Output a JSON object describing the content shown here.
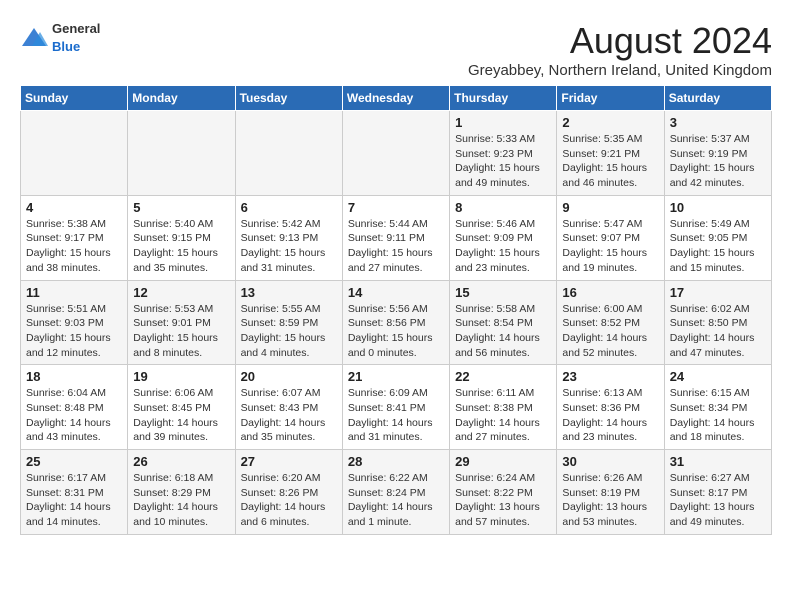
{
  "header": {
    "logo": {
      "general": "General",
      "blue": "Blue"
    },
    "title": "August 2024",
    "subtitle": "Greyabbey, Northern Ireland, United Kingdom"
  },
  "weekdays": [
    "Sunday",
    "Monday",
    "Tuesday",
    "Wednesday",
    "Thursday",
    "Friday",
    "Saturday"
  ],
  "weeks": [
    [
      {
        "day": "",
        "info": ""
      },
      {
        "day": "",
        "info": ""
      },
      {
        "day": "",
        "info": ""
      },
      {
        "day": "",
        "info": ""
      },
      {
        "day": "1",
        "info": "Sunrise: 5:33 AM\nSunset: 9:23 PM\nDaylight: 15 hours\nand 49 minutes."
      },
      {
        "day": "2",
        "info": "Sunrise: 5:35 AM\nSunset: 9:21 PM\nDaylight: 15 hours\nand 46 minutes."
      },
      {
        "day": "3",
        "info": "Sunrise: 5:37 AM\nSunset: 9:19 PM\nDaylight: 15 hours\nand 42 minutes."
      }
    ],
    [
      {
        "day": "4",
        "info": "Sunrise: 5:38 AM\nSunset: 9:17 PM\nDaylight: 15 hours\nand 38 minutes."
      },
      {
        "day": "5",
        "info": "Sunrise: 5:40 AM\nSunset: 9:15 PM\nDaylight: 15 hours\nand 35 minutes."
      },
      {
        "day": "6",
        "info": "Sunrise: 5:42 AM\nSunset: 9:13 PM\nDaylight: 15 hours\nand 31 minutes."
      },
      {
        "day": "7",
        "info": "Sunrise: 5:44 AM\nSunset: 9:11 PM\nDaylight: 15 hours\nand 27 minutes."
      },
      {
        "day": "8",
        "info": "Sunrise: 5:46 AM\nSunset: 9:09 PM\nDaylight: 15 hours\nand 23 minutes."
      },
      {
        "day": "9",
        "info": "Sunrise: 5:47 AM\nSunset: 9:07 PM\nDaylight: 15 hours\nand 19 minutes."
      },
      {
        "day": "10",
        "info": "Sunrise: 5:49 AM\nSunset: 9:05 PM\nDaylight: 15 hours\nand 15 minutes."
      }
    ],
    [
      {
        "day": "11",
        "info": "Sunrise: 5:51 AM\nSunset: 9:03 PM\nDaylight: 15 hours\nand 12 minutes."
      },
      {
        "day": "12",
        "info": "Sunrise: 5:53 AM\nSunset: 9:01 PM\nDaylight: 15 hours\nand 8 minutes."
      },
      {
        "day": "13",
        "info": "Sunrise: 5:55 AM\nSunset: 8:59 PM\nDaylight: 15 hours\nand 4 minutes."
      },
      {
        "day": "14",
        "info": "Sunrise: 5:56 AM\nSunset: 8:56 PM\nDaylight: 15 hours\nand 0 minutes."
      },
      {
        "day": "15",
        "info": "Sunrise: 5:58 AM\nSunset: 8:54 PM\nDaylight: 14 hours\nand 56 minutes."
      },
      {
        "day": "16",
        "info": "Sunrise: 6:00 AM\nSunset: 8:52 PM\nDaylight: 14 hours\nand 52 minutes."
      },
      {
        "day": "17",
        "info": "Sunrise: 6:02 AM\nSunset: 8:50 PM\nDaylight: 14 hours\nand 47 minutes."
      }
    ],
    [
      {
        "day": "18",
        "info": "Sunrise: 6:04 AM\nSunset: 8:48 PM\nDaylight: 14 hours\nand 43 minutes."
      },
      {
        "day": "19",
        "info": "Sunrise: 6:06 AM\nSunset: 8:45 PM\nDaylight: 14 hours\nand 39 minutes."
      },
      {
        "day": "20",
        "info": "Sunrise: 6:07 AM\nSunset: 8:43 PM\nDaylight: 14 hours\nand 35 minutes."
      },
      {
        "day": "21",
        "info": "Sunrise: 6:09 AM\nSunset: 8:41 PM\nDaylight: 14 hours\nand 31 minutes."
      },
      {
        "day": "22",
        "info": "Sunrise: 6:11 AM\nSunset: 8:38 PM\nDaylight: 14 hours\nand 27 minutes."
      },
      {
        "day": "23",
        "info": "Sunrise: 6:13 AM\nSunset: 8:36 PM\nDaylight: 14 hours\nand 23 minutes."
      },
      {
        "day": "24",
        "info": "Sunrise: 6:15 AM\nSunset: 8:34 PM\nDaylight: 14 hours\nand 18 minutes."
      }
    ],
    [
      {
        "day": "25",
        "info": "Sunrise: 6:17 AM\nSunset: 8:31 PM\nDaylight: 14 hours\nand 14 minutes."
      },
      {
        "day": "26",
        "info": "Sunrise: 6:18 AM\nSunset: 8:29 PM\nDaylight: 14 hours\nand 10 minutes."
      },
      {
        "day": "27",
        "info": "Sunrise: 6:20 AM\nSunset: 8:26 PM\nDaylight: 14 hours\nand 6 minutes."
      },
      {
        "day": "28",
        "info": "Sunrise: 6:22 AM\nSunset: 8:24 PM\nDaylight: 14 hours\nand 1 minute."
      },
      {
        "day": "29",
        "info": "Sunrise: 6:24 AM\nSunset: 8:22 PM\nDaylight: 13 hours\nand 57 minutes."
      },
      {
        "day": "30",
        "info": "Sunrise: 6:26 AM\nSunset: 8:19 PM\nDaylight: 13 hours\nand 53 minutes."
      },
      {
        "day": "31",
        "info": "Sunrise: 6:27 AM\nSunset: 8:17 PM\nDaylight: 13 hours\nand 49 minutes."
      }
    ]
  ]
}
